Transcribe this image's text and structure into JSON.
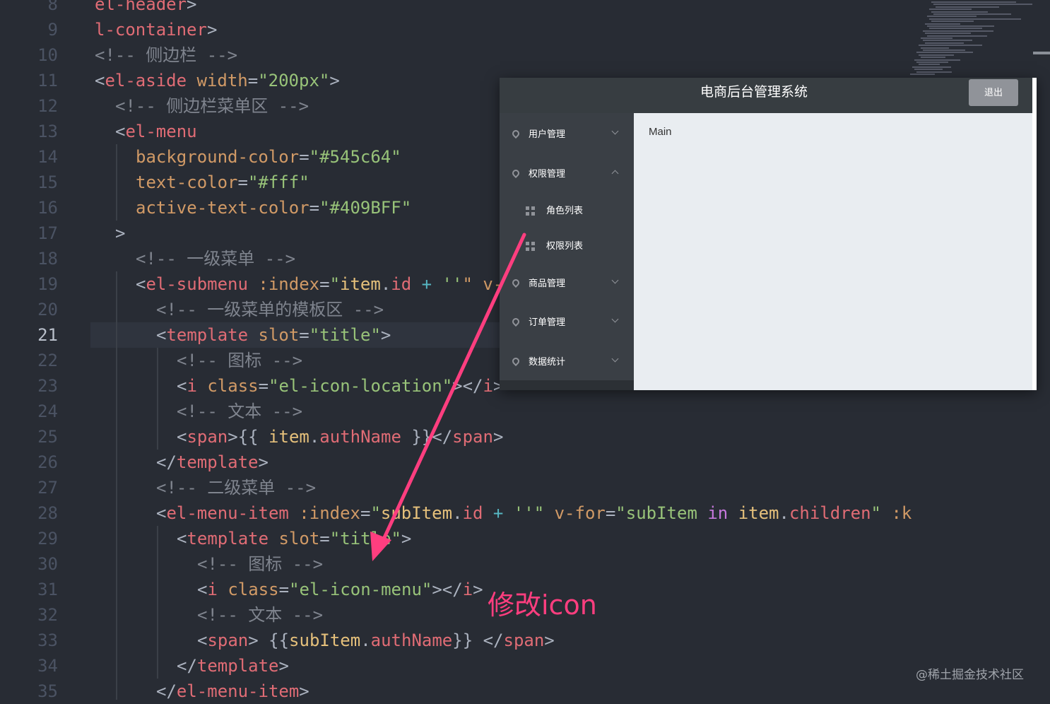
{
  "editor": {
    "active_line": "21",
    "lines": [
      {
        "no": "8",
        "tokens": [
          {
            "t": "el-header",
            "c": "t-tag"
          },
          {
            "t": ">",
            "c": "t-punct"
          }
        ]
      },
      {
        "no": "9",
        "tokens": [
          {
            "t": "l-container",
            "c": "t-tag"
          },
          {
            "t": ">",
            "c": "t-punct"
          }
        ]
      },
      {
        "no": "10",
        "tokens": [
          {
            "t": "<!-- 侧边栏 -->",
            "c": "t-cmt"
          }
        ]
      },
      {
        "no": "11",
        "tokens": [
          {
            "t": "<",
            "c": "t-punct"
          },
          {
            "t": "el-aside",
            "c": "t-tag"
          },
          {
            "t": " ",
            "c": "t-punct"
          },
          {
            "t": "width",
            "c": "t-attr"
          },
          {
            "t": "=",
            "c": "t-punct"
          },
          {
            "t": "\"200px\"",
            "c": "t-str"
          },
          {
            "t": ">",
            "c": "t-punct"
          }
        ]
      },
      {
        "no": "12",
        "tokens": [
          {
            "t": "<!-- 侧边栏菜单区 -->",
            "c": "t-cmt"
          }
        ]
      },
      {
        "no": "13",
        "tokens": [
          {
            "t": "<",
            "c": "t-punct"
          },
          {
            "t": "el-menu",
            "c": "t-tag"
          }
        ]
      },
      {
        "no": "14",
        "tokens": [
          {
            "t": "background-color",
            "c": "t-attr"
          },
          {
            "t": "=",
            "c": "t-punct"
          },
          {
            "t": "\"#545c64\"",
            "c": "t-str"
          }
        ]
      },
      {
        "no": "15",
        "tokens": [
          {
            "t": "text-color",
            "c": "t-attr"
          },
          {
            "t": "=",
            "c": "t-punct"
          },
          {
            "t": "\"#fff\"",
            "c": "t-str"
          }
        ]
      },
      {
        "no": "16",
        "tokens": [
          {
            "t": "active-text-color",
            "c": "t-attr"
          },
          {
            "t": "=",
            "c": "t-punct"
          },
          {
            "t": "\"#409BFF\"",
            "c": "t-str"
          }
        ]
      },
      {
        "no": "17",
        "tokens": [
          {
            "t": ">",
            "c": "t-punct"
          }
        ]
      },
      {
        "no": "18",
        "tokens": [
          {
            "t": "<!-- 一级菜单 -->",
            "c": "t-cmt"
          }
        ]
      },
      {
        "no": "19",
        "tokens": [
          {
            "t": "<",
            "c": "t-punct"
          },
          {
            "t": "el-submenu",
            "c": "t-tag"
          },
          {
            "t": " ",
            "c": "t-punct"
          },
          {
            "t": ":index",
            "c": "t-attr"
          },
          {
            "t": "=",
            "c": "t-punct"
          },
          {
            "t": "\"",
            "c": "t-str"
          },
          {
            "t": "item",
            "c": "t-var"
          },
          {
            "t": ".",
            "c": "t-punct"
          },
          {
            "t": "id",
            "c": "t-prop"
          },
          {
            "t": " + ",
            "c": "t-op"
          },
          {
            "t": "''",
            "c": "t-str"
          },
          {
            "t": "\" v-",
            "c": "t-attr"
          }
        ]
      },
      {
        "no": "20",
        "tokens": [
          {
            "t": "<!-- 一级菜单的模板区 -->",
            "c": "t-cmt"
          }
        ]
      },
      {
        "no": "21",
        "tokens": [
          {
            "t": "<",
            "c": "t-punct"
          },
          {
            "t": "template",
            "c": "t-tag"
          },
          {
            "t": " ",
            "c": "t-punct"
          },
          {
            "t": "slot",
            "c": "t-attr"
          },
          {
            "t": "=",
            "c": "t-punct"
          },
          {
            "t": "\"title\"",
            "c": "t-str"
          },
          {
            "t": ">",
            "c": "t-punct"
          }
        ]
      },
      {
        "no": "22",
        "tokens": [
          {
            "t": "<!-- 图标 -->",
            "c": "t-cmt"
          }
        ]
      },
      {
        "no": "23",
        "tokens": [
          {
            "t": "<",
            "c": "t-punct"
          },
          {
            "t": "i",
            "c": "t-tag"
          },
          {
            "t": " ",
            "c": "t-punct"
          },
          {
            "t": "class",
            "c": "t-attr"
          },
          {
            "t": "=",
            "c": "t-punct"
          },
          {
            "t": "\"el-icon-location\"",
            "c": "t-str"
          },
          {
            "t": "></",
            "c": "t-punct"
          },
          {
            "t": "i",
            "c": "t-tag"
          },
          {
            "t": ">",
            "c": "t-punct"
          }
        ]
      },
      {
        "no": "24",
        "tokens": [
          {
            "t": "<!-- 文本 -->",
            "c": "t-cmt"
          }
        ]
      },
      {
        "no": "25",
        "tokens": [
          {
            "t": "<",
            "c": "t-punct"
          },
          {
            "t": "span",
            "c": "t-tag"
          },
          {
            "t": ">{{ ",
            "c": "t-punct"
          },
          {
            "t": "item",
            "c": "t-var"
          },
          {
            "t": ".",
            "c": "t-punct"
          },
          {
            "t": "authName",
            "c": "t-prop"
          },
          {
            "t": " }}</",
            "c": "t-punct"
          },
          {
            "t": "span",
            "c": "t-tag"
          },
          {
            "t": ">",
            "c": "t-punct"
          }
        ]
      },
      {
        "no": "26",
        "tokens": [
          {
            "t": "</",
            "c": "t-punct"
          },
          {
            "t": "template",
            "c": "t-tag"
          },
          {
            "t": ">",
            "c": "t-punct"
          }
        ]
      },
      {
        "no": "27",
        "tokens": [
          {
            "t": "<!-- 二级菜单 -->",
            "c": "t-cmt"
          }
        ]
      },
      {
        "no": "28",
        "tokens": [
          {
            "t": "<",
            "c": "t-punct"
          },
          {
            "t": "el-menu-item",
            "c": "t-tag"
          },
          {
            "t": " ",
            "c": "t-punct"
          },
          {
            "t": ":index",
            "c": "t-attr"
          },
          {
            "t": "=",
            "c": "t-punct"
          },
          {
            "t": "\"",
            "c": "t-str"
          },
          {
            "t": "subItem",
            "c": "t-var"
          },
          {
            "t": ".",
            "c": "t-punct"
          },
          {
            "t": "id",
            "c": "t-prop"
          },
          {
            "t": " + ",
            "c": "t-op"
          },
          {
            "t": "''",
            "c": "t-str"
          },
          {
            "t": "\" ",
            "c": "t-str"
          },
          {
            "t": "v-for",
            "c": "t-attr"
          },
          {
            "t": "=",
            "c": "t-punct"
          },
          {
            "t": "\"",
            "c": "t-str"
          },
          {
            "t": "subItem",
            "c": "t-str"
          },
          {
            "t": " in ",
            "c": "t-kw"
          },
          {
            "t": "item",
            "c": "t-var"
          },
          {
            "t": ".",
            "c": "t-punct"
          },
          {
            "t": "children",
            "c": "t-prop"
          },
          {
            "t": "\"",
            "c": "t-str"
          },
          {
            "t": " :k",
            "c": "t-attr"
          }
        ]
      },
      {
        "no": "29",
        "tokens": [
          {
            "t": "<",
            "c": "t-punct"
          },
          {
            "t": "template",
            "c": "t-tag"
          },
          {
            "t": " ",
            "c": "t-punct"
          },
          {
            "t": "slot",
            "c": "t-attr"
          },
          {
            "t": "=",
            "c": "t-punct"
          },
          {
            "t": "\"title\"",
            "c": "t-str"
          },
          {
            "t": ">",
            "c": "t-punct"
          }
        ]
      },
      {
        "no": "30",
        "tokens": [
          {
            "t": "<!-- 图标 -->",
            "c": "t-cmt"
          }
        ]
      },
      {
        "no": "31",
        "tokens": [
          {
            "t": "<",
            "c": "t-punct"
          },
          {
            "t": "i",
            "c": "t-tag"
          },
          {
            "t": " ",
            "c": "t-punct"
          },
          {
            "t": "class",
            "c": "t-attr"
          },
          {
            "t": "=",
            "c": "t-punct"
          },
          {
            "t": "\"el-icon-menu\"",
            "c": "t-str"
          },
          {
            "t": "></",
            "c": "t-punct"
          },
          {
            "t": "i",
            "c": "t-tag"
          },
          {
            "t": ">",
            "c": "t-punct"
          }
        ]
      },
      {
        "no": "32",
        "tokens": [
          {
            "t": "<!-- 文本 -->",
            "c": "t-cmt"
          }
        ]
      },
      {
        "no": "33",
        "tokens": [
          {
            "t": "<",
            "c": "t-punct"
          },
          {
            "t": "span",
            "c": "t-tag"
          },
          {
            "t": "> {{",
            "c": "t-punct"
          },
          {
            "t": "subItem",
            "c": "t-var"
          },
          {
            "t": ".",
            "c": "t-punct"
          },
          {
            "t": "authName",
            "c": "t-prop"
          },
          {
            "t": "}} </",
            "c": "t-punct"
          },
          {
            "t": "span",
            "c": "t-tag"
          },
          {
            "t": ">",
            "c": "t-punct"
          }
        ]
      },
      {
        "no": "34",
        "tokens": [
          {
            "t": "</",
            "c": "t-punct"
          },
          {
            "t": "template",
            "c": "t-tag"
          },
          {
            "t": ">",
            "c": "t-punct"
          }
        ]
      },
      {
        "no": "35",
        "tokens": [
          {
            "t": "</",
            "c": "t-punct"
          },
          {
            "t": "el-menu-item",
            "c": "t-tag"
          },
          {
            "t": ">",
            "c": "t-punct"
          }
        ]
      }
    ]
  },
  "preview": {
    "title": "电商后台管理系统",
    "logout_label": "退出",
    "main_text": "Main",
    "menu": {
      "users": "用户管理",
      "rights": "权限管理",
      "roles_list": "角色列表",
      "rights_list": "权限列表",
      "goods": "商品管理",
      "orders": "订单管理",
      "reports": "数据统计"
    }
  },
  "annotation": "修改icon",
  "watermark": "@稀土掘金技术社区",
  "colors": {
    "editor_bg": "#282c34",
    "aside_bg": "#3a3f45",
    "header_bg": "#373d41",
    "annotation": "#ff3e7f",
    "logout_bg": "#909399"
  }
}
